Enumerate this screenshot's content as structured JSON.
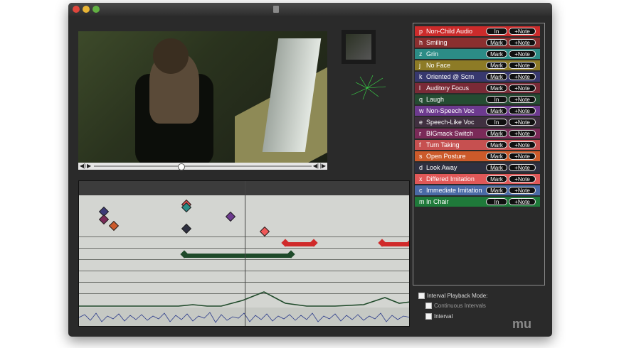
{
  "window": {
    "title": ""
  },
  "codes": [
    {
      "key": "p",
      "label": "Non-Child Audio",
      "button1": "In",
      "button2": "+Note",
      "color": "#cc2b2b"
    },
    {
      "key": "h",
      "label": "Smiling",
      "button1": "Mark",
      "button2": "+Note",
      "color": "#8b2f2f"
    },
    {
      "key": "z",
      "label": "Grin",
      "button1": "Mark",
      "button2": "+Note",
      "color": "#2c8c86"
    },
    {
      "key": "j",
      "label": "No Face",
      "button1": "Mark",
      "button2": "+Note",
      "color": "#8d7b26"
    },
    {
      "key": "k",
      "label": "Oriented @ Scrn",
      "button1": "Mark",
      "button2": "+Note",
      "color": "#37386e"
    },
    {
      "key": "l",
      "label": "Auditory Focus",
      "button1": "Mark",
      "button2": "+Note",
      "color": "#7a2a36"
    },
    {
      "key": "q",
      "label": "Laugh",
      "button1": "In",
      "button2": "+Note",
      "color": "#244c32"
    },
    {
      "key": "w",
      "label": "Non-Speech Voc",
      "button1": "Mark",
      "button2": "+Note",
      "color": "#6d3a8f"
    },
    {
      "key": "e",
      "label": "Speech-Like Voc",
      "button1": "In",
      "button2": "+Note",
      "color": "#403040"
    },
    {
      "key": "r",
      "label": "BIGmack Switch",
      "button1": "Mark",
      "button2": "+Note",
      "color": "#7a2a58"
    },
    {
      "key": "f",
      "label": "Turn Taking",
      "button1": "Mark",
      "button2": "+Note",
      "color": "#c65050"
    },
    {
      "key": "s",
      "label": "Open Posture",
      "button1": "Mark",
      "button2": "+Note",
      "color": "#cc5a2a"
    },
    {
      "key": "d",
      "label": "Look Away",
      "button1": "Mark",
      "button2": "+Note",
      "color": "#2e3040"
    },
    {
      "key": "x",
      "label": "Differed Imitation",
      "button1": "Mark",
      "button2": "+Note",
      "color": "#e05858"
    },
    {
      "key": "c",
      "label": "Immediate Imitation",
      "button1": "Mark",
      "button2": "+Note",
      "color": "#4a6aa6"
    },
    {
      "key": "m",
      "label": "In Chair",
      "button1": "In",
      "button2": "+Note",
      "color": "#1f7a3a"
    }
  ],
  "options": {
    "interval_playback_label": "Interval Playback Mode:",
    "continuous_label": "Continuous Intervals",
    "interval_label": "Interval"
  },
  "logo_text": "mu"
}
